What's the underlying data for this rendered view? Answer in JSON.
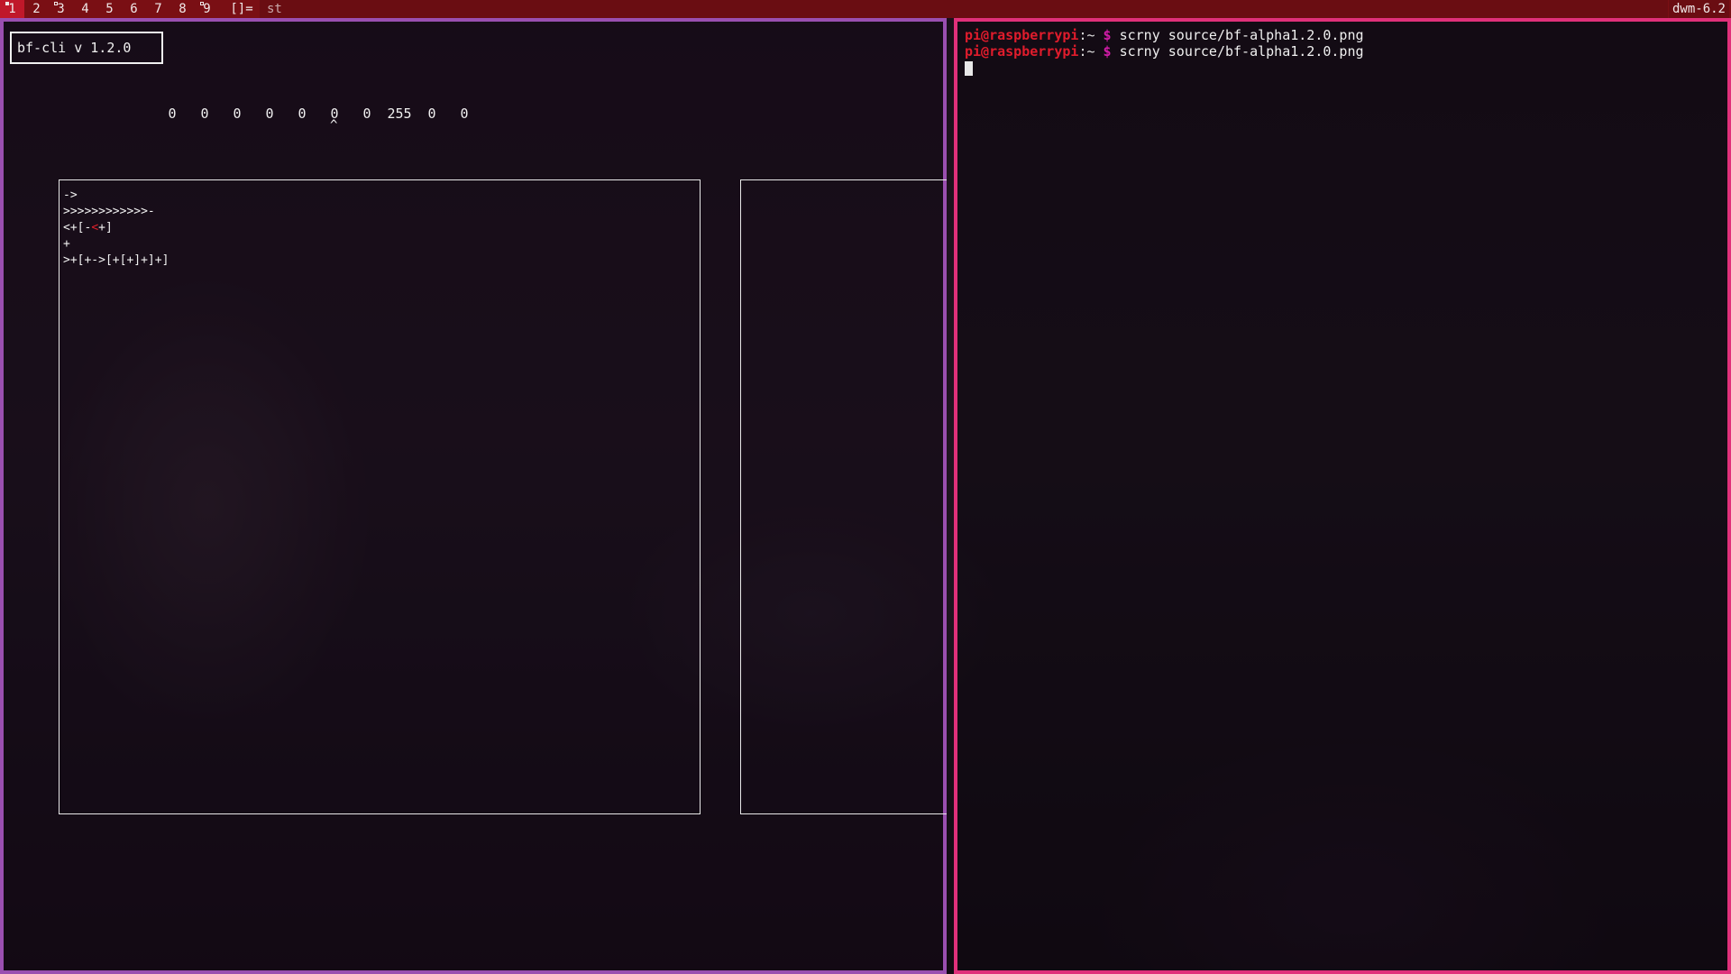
{
  "bar": {
    "tags": [
      {
        "label": "1",
        "selected": true,
        "occupied": false
      },
      {
        "label": "2",
        "selected": false,
        "occupied": false
      },
      {
        "label": "3",
        "selected": false,
        "occupied": true
      },
      {
        "label": "4",
        "selected": false,
        "occupied": false
      },
      {
        "label": "5",
        "selected": false,
        "occupied": false
      },
      {
        "label": "6",
        "selected": false,
        "occupied": false
      },
      {
        "label": "7",
        "selected": false,
        "occupied": false
      },
      {
        "label": "8",
        "selected": false,
        "occupied": false
      },
      {
        "label": "9",
        "selected": false,
        "occupied": true
      }
    ],
    "layout_symbol": "[]=",
    "window_title": "st",
    "status_text": "dwm-6.2",
    "colors": {
      "bar_bg": "#7a0f14",
      "selected_tag": "#c0182a"
    }
  },
  "bf_cli": {
    "version": "bf-cli v 1.2.0",
    "cells": [
      "0",
      "0",
      "0",
      "0",
      "0",
      "0",
      "0",
      "255",
      "0",
      "0"
    ],
    "pointer_index": 5,
    "pointer_symbol": "^",
    "code_lines": [
      {
        "pre": "->",
        "hl": "",
        "post": ""
      },
      {
        "pre": ">>>>>>>>>>>>-",
        "hl": "",
        "post": ""
      },
      {
        "pre": "<+[-",
        "hl": "<",
        "post": "+]"
      },
      {
        "pre": "+",
        "hl": "",
        "post": ""
      },
      {
        "pre": ">+[+->[+[+]+]+]",
        "hl": "",
        "post": ""
      }
    ]
  },
  "terminal": {
    "lines": [
      {
        "user": "pi@raspberrypi",
        "path": ":~",
        "symbol": "$",
        "command": "scrny source/bf-alpha1.2.0.png"
      },
      {
        "user": "pi@raspberrypi",
        "path": ":~",
        "symbol": "$",
        "command": "scrny source/bf-alpha1.2.0.png"
      }
    ],
    "colors": {
      "border_focused": "#e0307a",
      "border_unfocused": "#9a4fb0"
    }
  }
}
